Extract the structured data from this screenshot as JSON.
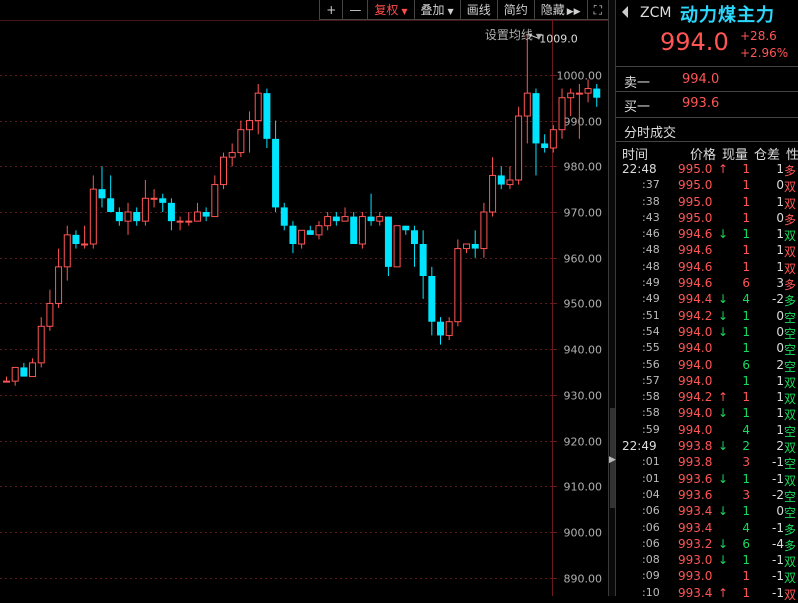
{
  "toolbar": {
    "zoom_in": "+",
    "zoom_out": "—",
    "adjust_label": "复权",
    "overlay_label": "叠加",
    "draw_label": "画线",
    "simple_label": "简约",
    "hide_label": "隐藏",
    "expand_icon": "expand-icon"
  },
  "ma_setting_label": "设置均线",
  "colors": {
    "up": "#ff5555",
    "down": "#00e5ff",
    "name": "#2bd9ff",
    "buy_green": "#19d95c",
    "grid": "#5a1c1c"
  },
  "chart_data": {
    "type": "candlestick",
    "ylim": [
      886,
      1012
    ],
    "y_ticks": [
      890,
      900,
      910,
      920,
      930,
      940,
      950,
      960,
      970,
      980,
      990,
      1000
    ],
    "y_tick_labels": [
      "890.00",
      "900.00",
      "910.00",
      "920.00",
      "930.00",
      "940.00",
      "950.00",
      "960.00",
      "970.00",
      "980.00",
      "990.00",
      "1000.00"
    ],
    "annotation": {
      "label": "1009.0",
      "value": 1009.0,
      "candle_index": 64
    },
    "candles": [
      {
        "o": 933,
        "h": 934,
        "l": 933,
        "c": 933
      },
      {
        "o": 933,
        "h": 936,
        "l": 932,
        "c": 936
      },
      {
        "o": 936,
        "h": 937,
        "l": 934,
        "c": 934
      },
      {
        "o": 934,
        "h": 938,
        "l": 934,
        "c": 937
      },
      {
        "o": 937,
        "h": 947,
        "l": 936,
        "c": 945
      },
      {
        "o": 945,
        "h": 953,
        "l": 944,
        "c": 950
      },
      {
        "o": 950,
        "h": 962,
        "l": 949,
        "c": 958
      },
      {
        "o": 958,
        "h": 967,
        "l": 955,
        "c": 965
      },
      {
        "o": 965,
        "h": 966,
        "l": 962,
        "c": 963
      },
      {
        "o": 963,
        "h": 967,
        "l": 962,
        "c": 963
      },
      {
        "o": 963,
        "h": 978,
        "l": 962,
        "c": 975
      },
      {
        "o": 975,
        "h": 980,
        "l": 971,
        "c": 973
      },
      {
        "o": 973,
        "h": 978,
        "l": 970,
        "c": 970
      },
      {
        "o": 970,
        "h": 971,
        "l": 967,
        "c": 968
      },
      {
        "o": 968,
        "h": 972,
        "l": 965,
        "c": 970
      },
      {
        "o": 970,
        "h": 971,
        "l": 967,
        "c": 968
      },
      {
        "o": 968,
        "h": 977,
        "l": 967,
        "c": 973
      },
      {
        "o": 973,
        "h": 975,
        "l": 971,
        "c": 973
      },
      {
        "o": 973,
        "h": 974,
        "l": 970,
        "c": 972
      },
      {
        "o": 972,
        "h": 973,
        "l": 966,
        "c": 968
      },
      {
        "o": 968,
        "h": 969,
        "l": 966,
        "c": 968
      },
      {
        "o": 968,
        "h": 970,
        "l": 967,
        "c": 968
      },
      {
        "o": 968,
        "h": 972,
        "l": 968,
        "c": 970
      },
      {
        "o": 970,
        "h": 971,
        "l": 968,
        "c": 969
      },
      {
        "o": 969,
        "h": 978,
        "l": 969,
        "c": 976
      },
      {
        "o": 976,
        "h": 983,
        "l": 975,
        "c": 982
      },
      {
        "o": 982,
        "h": 985,
        "l": 980,
        "c": 983
      },
      {
        "o": 983,
        "h": 990,
        "l": 982,
        "c": 988
      },
      {
        "o": 988,
        "h": 992,
        "l": 983,
        "c": 990
      },
      {
        "o": 990,
        "h": 998,
        "l": 987,
        "c": 996
      },
      {
        "o": 996,
        "h": 997,
        "l": 984,
        "c": 986
      },
      {
        "o": 986,
        "h": 990,
        "l": 970,
        "c": 971
      },
      {
        "o": 971,
        "h": 972,
        "l": 966,
        "c": 967
      },
      {
        "o": 967,
        "h": 968,
        "l": 961,
        "c": 963
      },
      {
        "o": 963,
        "h": 966,
        "l": 962,
        "c": 966
      },
      {
        "o": 966,
        "h": 967,
        "l": 965,
        "c": 965
      },
      {
        "o": 965,
        "h": 968,
        "l": 964,
        "c": 967
      },
      {
        "o": 967,
        "h": 970,
        "l": 966,
        "c": 969
      },
      {
        "o": 969,
        "h": 970,
        "l": 967,
        "c": 968
      },
      {
        "o": 968,
        "h": 971,
        "l": 968,
        "c": 969
      },
      {
        "o": 969,
        "h": 970,
        "l": 963,
        "c": 963
      },
      {
        "o": 963,
        "h": 970,
        "l": 962,
        "c": 969
      },
      {
        "o": 969,
        "h": 974,
        "l": 967,
        "c": 968
      },
      {
        "o": 968,
        "h": 970,
        "l": 967,
        "c": 969
      },
      {
        "o": 969,
        "h": 969,
        "l": 956,
        "c": 958
      },
      {
        "o": 958,
        "h": 967,
        "l": 958,
        "c": 967
      },
      {
        "o": 967,
        "h": 967,
        "l": 965,
        "c": 966
      },
      {
        "o": 966,
        "h": 967,
        "l": 958,
        "c": 963
      },
      {
        "o": 963,
        "h": 966,
        "l": 951,
        "c": 956
      },
      {
        "o": 956,
        "h": 958,
        "l": 943,
        "c": 946
      },
      {
        "o": 946,
        "h": 947,
        "l": 941,
        "c": 943
      },
      {
        "o": 943,
        "h": 947,
        "l": 942,
        "c": 946
      },
      {
        "o": 946,
        "h": 964,
        "l": 945,
        "c": 962
      },
      {
        "o": 962,
        "h": 963,
        "l": 961,
        "c": 963
      },
      {
        "o": 963,
        "h": 966,
        "l": 960,
        "c": 962
      },
      {
        "o": 962,
        "h": 972,
        "l": 960,
        "c": 970
      },
      {
        "o": 970,
        "h": 982,
        "l": 969,
        "c": 978
      },
      {
        "o": 978,
        "h": 980,
        "l": 975,
        "c": 976
      },
      {
        "o": 976,
        "h": 980,
        "l": 975,
        "c": 977
      },
      {
        "o": 977,
        "h": 993,
        "l": 976,
        "c": 991
      },
      {
        "o": 991,
        "h": 1009,
        "l": 985,
        "c": 996
      },
      {
        "o": 996,
        "h": 997,
        "l": 978,
        "c": 985
      },
      {
        "o": 985,
        "h": 987,
        "l": 983,
        "c": 984
      },
      {
        "o": 984,
        "h": 989,
        "l": 983,
        "c": 988
      },
      {
        "o": 988,
        "h": 997,
        "l": 986,
        "c": 995
      },
      {
        "o": 995,
        "h": 997,
        "l": 991,
        "c": 996
      },
      {
        "o": 996,
        "h": 998,
        "l": 986,
        "c": 996
      },
      {
        "o": 996,
        "h": 999,
        "l": 994,
        "c": 997
      },
      {
        "o": 997,
        "h": 998,
        "l": 993,
        "c": 995
      }
    ]
  },
  "quote": {
    "code": "ZCM",
    "name": "动力煤主力",
    "price": "994.0",
    "change": "+28.6",
    "change_pct": "+2.96%",
    "sell1_label": "卖一",
    "sell1_price": "994.0",
    "buy1_label": "买一",
    "buy1_price": "993.6"
  },
  "ticks": {
    "title": "分时成交",
    "headers": {
      "time": "时间",
      "price": "价格",
      "vol": "现量",
      "oi": "仓差",
      "nature": "性"
    },
    "rows": [
      {
        "time": "22:48",
        "main": true,
        "price": "995.0",
        "pc": "red",
        "arrow": "↑",
        "ac": "red",
        "vol": "1",
        "vc": "red",
        "oi": "1",
        "dir": "多",
        "dc": "red"
      },
      {
        "time": ":37",
        "price": "995.0",
        "pc": "red",
        "arrow": "",
        "ac": "",
        "vol": "1",
        "vc": "red",
        "oi": "0",
        "dir": "双",
        "dc": "red"
      },
      {
        "time": ":38",
        "price": "995.0",
        "pc": "red",
        "arrow": "",
        "ac": "",
        "vol": "1",
        "vc": "red",
        "oi": "1",
        "dir": "双",
        "dc": "red"
      },
      {
        "time": ":43",
        "price": "995.0",
        "pc": "red",
        "arrow": "",
        "ac": "",
        "vol": "1",
        "vc": "red",
        "oi": "0",
        "dir": "多",
        "dc": "red"
      },
      {
        "time": ":46",
        "price": "994.6",
        "pc": "red",
        "arrow": "↓",
        "ac": "green",
        "vol": "1",
        "vc": "green",
        "oi": "1",
        "dir": "双",
        "dc": "green"
      },
      {
        "time": ":48",
        "price": "994.6",
        "pc": "red",
        "arrow": "",
        "ac": "",
        "vol": "1",
        "vc": "red",
        "oi": "1",
        "dir": "双",
        "dc": "red"
      },
      {
        "time": ":48",
        "price": "994.6",
        "pc": "red",
        "arrow": "",
        "ac": "",
        "vol": "1",
        "vc": "red",
        "oi": "1",
        "dir": "双",
        "dc": "red"
      },
      {
        "time": ":49",
        "price": "994.6",
        "pc": "red",
        "arrow": "",
        "ac": "",
        "vol": "6",
        "vc": "red",
        "oi": "3",
        "dir": "多",
        "dc": "red"
      },
      {
        "time": ":49",
        "price": "994.4",
        "pc": "red",
        "arrow": "↓",
        "ac": "green",
        "vol": "4",
        "vc": "green",
        "oi": "-2",
        "dir": "多",
        "dc": "green"
      },
      {
        "time": ":51",
        "price": "994.2",
        "pc": "red",
        "arrow": "↓",
        "ac": "green",
        "vol": "1",
        "vc": "green",
        "oi": "0",
        "dir": "空",
        "dc": "green"
      },
      {
        "time": ":54",
        "price": "994.0",
        "pc": "red",
        "arrow": "↓",
        "ac": "green",
        "vol": "1",
        "vc": "green",
        "oi": "0",
        "dir": "空",
        "dc": "green"
      },
      {
        "time": ":55",
        "price": "994.0",
        "pc": "red",
        "arrow": "",
        "ac": "",
        "vol": "1",
        "vc": "green",
        "oi": "0",
        "dir": "空",
        "dc": "green"
      },
      {
        "time": ":56",
        "price": "994.0",
        "pc": "red",
        "arrow": "",
        "ac": "",
        "vol": "6",
        "vc": "green",
        "oi": "2",
        "dir": "空",
        "dc": "green"
      },
      {
        "time": ":57",
        "price": "994.0",
        "pc": "red",
        "arrow": "",
        "ac": "",
        "vol": "1",
        "vc": "green",
        "oi": "1",
        "dir": "双",
        "dc": "green"
      },
      {
        "time": ":58",
        "price": "994.2",
        "pc": "red",
        "arrow": "↑",
        "ac": "red",
        "vol": "1",
        "vc": "red",
        "oi": "1",
        "dir": "双",
        "dc": "green"
      },
      {
        "time": ":58",
        "price": "994.0",
        "pc": "red",
        "arrow": "↓",
        "ac": "green",
        "vol": "1",
        "vc": "green",
        "oi": "1",
        "dir": "双",
        "dc": "green"
      },
      {
        "time": ":59",
        "price": "994.0",
        "pc": "red",
        "arrow": "",
        "ac": "",
        "vol": "4",
        "vc": "green",
        "oi": "1",
        "dir": "空",
        "dc": "green"
      },
      {
        "time": "22:49",
        "main": true,
        "price": "993.8",
        "pc": "red",
        "arrow": "↓",
        "ac": "green",
        "vol": "2",
        "vc": "green",
        "oi": "2",
        "dir": "双",
        "dc": "green"
      },
      {
        "time": ":01",
        "price": "993.8",
        "pc": "red",
        "arrow": "",
        "ac": "",
        "vol": "3",
        "vc": "red",
        "oi": "-1",
        "dir": "空",
        "dc": "green"
      },
      {
        "time": ":01",
        "price": "993.6",
        "pc": "red",
        "arrow": "↓",
        "ac": "green",
        "vol": "1",
        "vc": "green",
        "oi": "-1",
        "dir": "双",
        "dc": "green"
      },
      {
        "time": ":04",
        "price": "993.6",
        "pc": "red",
        "arrow": "",
        "ac": "",
        "vol": "3",
        "vc": "red",
        "oi": "-2",
        "dir": "空",
        "dc": "green"
      },
      {
        "time": ":06",
        "price": "993.4",
        "pc": "red",
        "arrow": "↓",
        "ac": "green",
        "vol": "1",
        "vc": "green",
        "oi": "0",
        "dir": "空",
        "dc": "green"
      },
      {
        "time": ":06",
        "price": "993.4",
        "pc": "red",
        "arrow": "",
        "ac": "",
        "vol": "4",
        "vc": "green",
        "oi": "-1",
        "dir": "多",
        "dc": "green"
      },
      {
        "time": ":06",
        "price": "993.2",
        "pc": "red",
        "arrow": "↓",
        "ac": "green",
        "vol": "6",
        "vc": "green",
        "oi": "-4",
        "dir": "多",
        "dc": "green"
      },
      {
        "time": ":08",
        "price": "993.0",
        "pc": "red",
        "arrow": "↓",
        "ac": "green",
        "vol": "1",
        "vc": "green",
        "oi": "-1",
        "dir": "双",
        "dc": "green"
      },
      {
        "time": ":09",
        "price": "993.0",
        "pc": "red",
        "arrow": "",
        "ac": "",
        "vol": "1",
        "vc": "red",
        "oi": "-1",
        "dir": "双",
        "dc": "green"
      },
      {
        "time": ":10",
        "price": "993.4",
        "pc": "red",
        "arrow": "↑",
        "ac": "red",
        "vol": "1",
        "vc": "red",
        "oi": "-1",
        "dir": "双",
        "dc": "red"
      }
    ]
  }
}
